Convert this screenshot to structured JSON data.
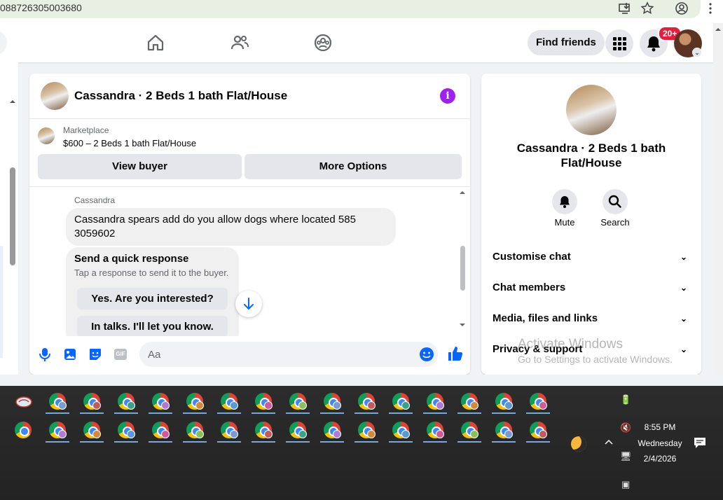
{
  "browser": {
    "url_fragment": "088726305003680"
  },
  "header": {
    "find_friends_label": "Find friends",
    "notification_count": "20+"
  },
  "chat": {
    "title": "Cassandra · 2 Beds 1 bath Flat/House",
    "marketplace_label": "Marketplace",
    "listing": "$600 – 2 Beds 1 bath Flat/House",
    "view_buyer_label": "View buyer",
    "more_options_label": "More Options",
    "sender_name": "Cassandra",
    "message": "Cassandra spears add do you allow dogs where located 585 3059602",
    "quick_response": {
      "title": "Send a quick response",
      "subtitle": "Tap a response to send it to the buyer.",
      "options": [
        "Yes. Are you interested?",
        "In talks. I'll let you know."
      ]
    },
    "composer_placeholder": "Aa",
    "gif_label": "GIF"
  },
  "info_panel": {
    "name": "Cassandra · 2 Beds 1 bath Flat/House",
    "actions": [
      {
        "label": "Mute",
        "icon": "bell-icon"
      },
      {
        "label": "Search",
        "icon": "search-icon"
      }
    ],
    "sections": [
      "Customise chat",
      "Chat members",
      "Media, files and links",
      "Privacy & support"
    ]
  },
  "watermark": {
    "line1": "Activate Windows",
    "line2": "Go to Settings to activate Windows."
  },
  "taskbar": {
    "time": "8:55 PM",
    "day": "Wednesday",
    "date": "2/4/2026"
  },
  "colors": {
    "facebook_blue": "#0866ff",
    "messenger_purple": "#a020f0",
    "badge_red": "#e41e3f"
  }
}
